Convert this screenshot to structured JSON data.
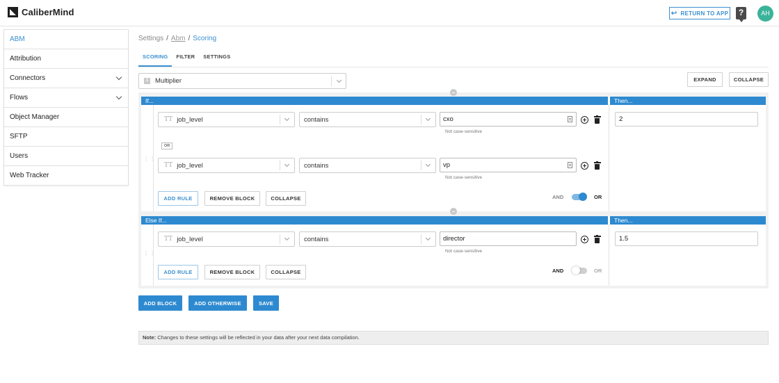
{
  "header": {
    "brand": "CaliberMind",
    "return_label": "RETURN TO APP",
    "help_glyph": "?",
    "avatar_initials": "AH"
  },
  "sidebar": {
    "items": [
      {
        "label": "ABM",
        "active": true,
        "expandable": false
      },
      {
        "label": "Attribution",
        "expandable": false
      },
      {
        "label": "Connectors",
        "expandable": true
      },
      {
        "label": "Flows",
        "expandable": true
      },
      {
        "label": "Object Manager",
        "expandable": false
      },
      {
        "label": "SFTP",
        "expandable": false
      },
      {
        "label": "Users",
        "expandable": false
      },
      {
        "label": "Web Tracker",
        "expandable": false
      }
    ]
  },
  "breadcrumb": {
    "root": "Settings",
    "section": "Abm",
    "current": "Scoring"
  },
  "tabs": [
    "SCORING",
    "FILTER",
    "SETTINGS"
  ],
  "mode": {
    "number": "1",
    "label": "Multiplier"
  },
  "actions": {
    "expand": "EXPAND",
    "collapse": "COLLAPSE"
  },
  "blocks": [
    {
      "header_left": "If...",
      "header_right": "Then...",
      "rules": [
        {
          "field": "job_level",
          "operator": "contains",
          "value": "cxo",
          "hint": "Not case-sensitive"
        },
        {
          "field": "job_level",
          "operator": "contains",
          "value": "vp",
          "hint": "Not case-sensitive"
        }
      ],
      "joiner": "OR",
      "then_value": "2",
      "buttons": {
        "add_rule": "ADD RULE",
        "remove_block": "REMOVE BLOCK",
        "collapse": "COLLAPSE"
      },
      "toggle": {
        "and": "AND",
        "or": "OR",
        "selected": "OR"
      }
    },
    {
      "header_left": "Else If...",
      "header_right": "Then...",
      "rules": [
        {
          "field": "job_level",
          "operator": "contains",
          "value": "director",
          "hint": "Not case-sensitive"
        }
      ],
      "then_value": "1.5",
      "buttons": {
        "add_rule": "ADD RULE",
        "remove_block": "REMOVE BLOCK",
        "collapse": "COLLAPSE"
      },
      "toggle": {
        "and": "AND",
        "or": "OR",
        "selected": "AND"
      }
    }
  ],
  "footer_buttons": {
    "add_block": "ADD BLOCK",
    "add_otherwise": "ADD OTHERWISE",
    "save": "SAVE"
  },
  "note": {
    "label": "Note:",
    "text": "Changes to these settings will be reflected in your data after your next data compilation."
  },
  "colors": {
    "accent": "#2e8ad0",
    "avatar": "#3bb39a"
  }
}
